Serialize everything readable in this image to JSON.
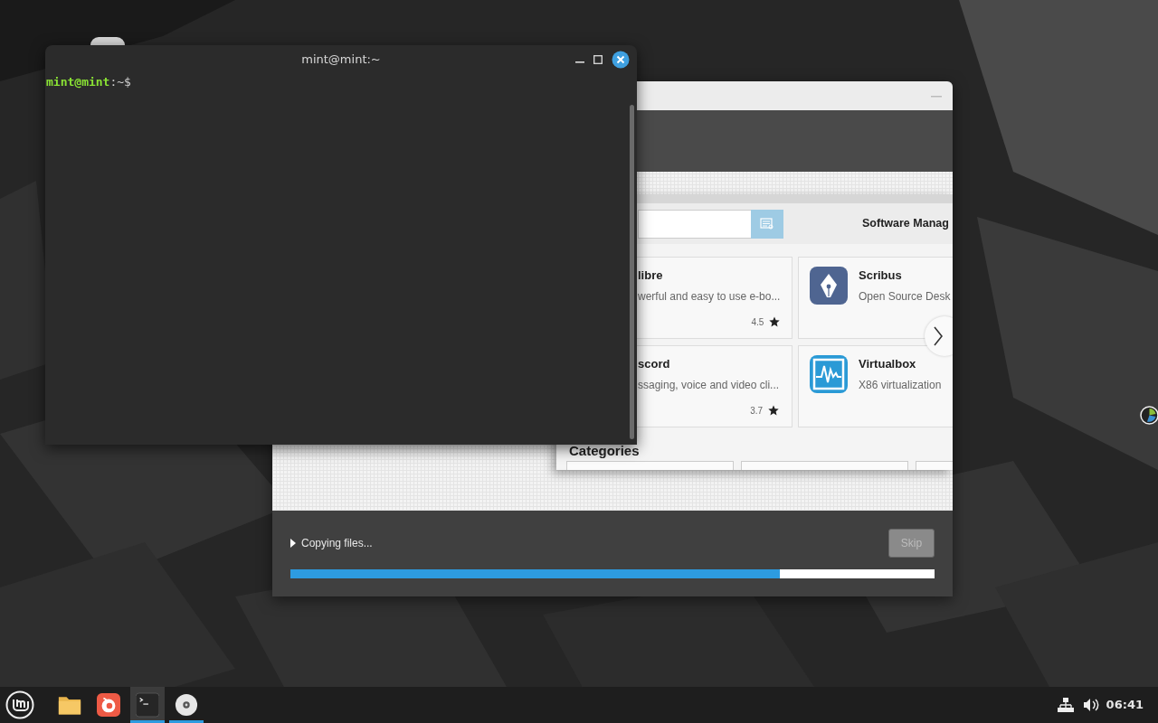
{
  "terminal": {
    "title": "mint@mint:~",
    "prompt_user": "mint@mint",
    "prompt_path": ":~$"
  },
  "installer": {
    "slideshow": {
      "app_title": "Software Manag",
      "apps": [
        {
          "name": "libre",
          "description": "werful and easy to use e-bo...",
          "rating": "4.5"
        },
        {
          "name": "Scribus",
          "description": "Open Source Desk"
        },
        {
          "name": "scord",
          "description": "ssaging, voice and video cli...",
          "rating": "3.7"
        },
        {
          "name": "Virtualbox",
          "description": "X86 virtualization"
        }
      ],
      "section_heading": "Categories"
    },
    "status": "Copying files...",
    "progress": {
      "level": 0.76
    },
    "skip_button": {
      "label": "Skip",
      "disabled": true
    }
  },
  "taskbar": {
    "apps": [
      {
        "kind": "files",
        "active": false,
        "running": false
      },
      {
        "kind": "browser",
        "active": false,
        "running": false
      },
      {
        "kind": "terminal",
        "active": true,
        "running": true
      },
      {
        "kind": "disc",
        "active": false,
        "running": true
      }
    ],
    "clock": "06:41"
  }
}
